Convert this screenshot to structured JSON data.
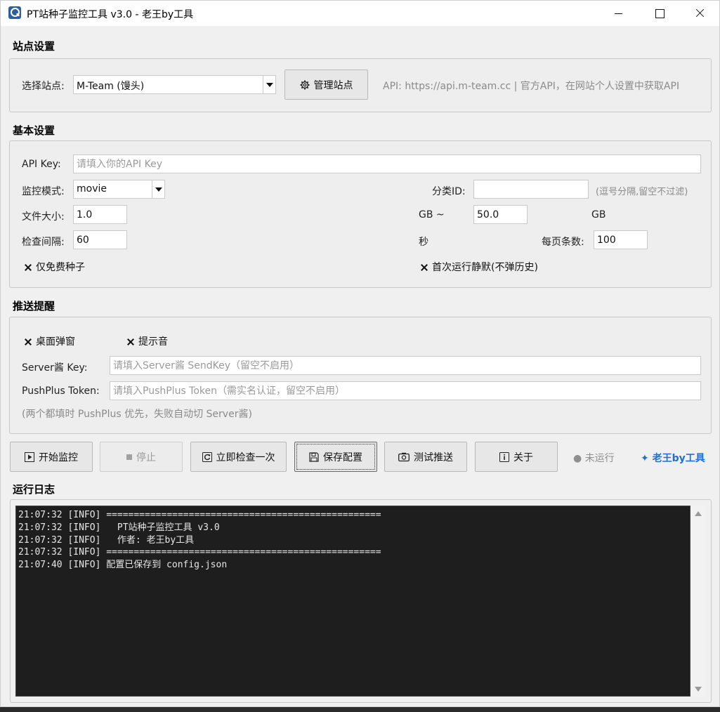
{
  "window": {
    "title": "PT站种子监控工具 v3.0 - 老王by工具"
  },
  "site_settings": {
    "section_title": "站点设置",
    "select_label": "选择站点:",
    "selected_site": "M-Team (馒头)",
    "manage_button": "管理站点",
    "api_info": "API: https://api.m-team.cc  |  官方API，在网站个人设置中获取API"
  },
  "basic_settings": {
    "section_title": "基本设置",
    "api_key_label": "API Key:",
    "api_key_placeholder": "请填入你的API Key",
    "api_key_value": "",
    "mode_label": "监控模式:",
    "mode_value": "movie",
    "category_label": "分类ID:",
    "category_value": "",
    "category_hint": "(逗号分隔,留空不过滤)",
    "size_label": "文件大小:",
    "size_min": "1.0",
    "size_sep": "GB ~",
    "size_max": "50.0",
    "size_unit": "GB",
    "interval_label": "检查间隔:",
    "interval_value": "60",
    "interval_unit": "秒",
    "per_page_label": "每页条数:",
    "per_page_value": "100",
    "free_only_label": "仅免费种子",
    "free_only_checked": true,
    "silent_first_label": "首次运行静默(不弹历史)",
    "silent_first_checked": true
  },
  "push_settings": {
    "section_title": "推送提醒",
    "desktop_popup_label": "桌面弹窗",
    "desktop_popup_checked": true,
    "sound_label": "提示音",
    "sound_checked": true,
    "serverchan_label": "Server酱 Key:",
    "serverchan_placeholder": "请填入Server酱 SendKey（留空不启用）",
    "pushplus_label": "PushPlus Token:",
    "pushplus_placeholder": "请填入PushPlus Token（需实名认证，留空不启用）",
    "note": "(两个都填时 PushPlus 优先，失败自动切 Server酱)"
  },
  "toolbar": {
    "start": "开始监控",
    "stop": "停止",
    "check_now": "立即检查一次",
    "save": "保存配置",
    "test_push": "测试推送",
    "about": "关于",
    "status": "● 未运行",
    "brand": "✦ 老王by工具"
  },
  "log": {
    "section_title": "运行日志",
    "lines": [
      "21:07:32 [INFO] ==================================================",
      "21:07:32 [INFO]   PT站种子监控工具 v3.0",
      "21:07:32 [INFO]   作者: 老王by工具",
      "21:07:32 [INFO] ==================================================",
      "21:07:40 [INFO] 配置已保存到 config.json"
    ]
  },
  "colors": {
    "accent": "#1f6fd6",
    "log_bg": "#1e1e1e",
    "window_bg": "#f0f0f0"
  }
}
